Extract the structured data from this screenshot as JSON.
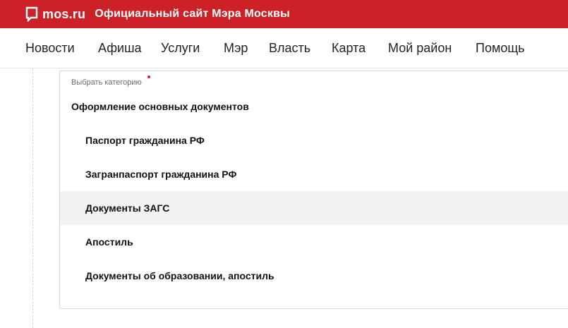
{
  "header": {
    "logo_text": "mos.ru",
    "site_title": "Официальный сайт Мэра Москвы",
    "brand_color": "#cc2127",
    "logo_icon": "speech-bubble-icon"
  },
  "nav": {
    "items": [
      {
        "label": "Новости"
      },
      {
        "label": "Афиша"
      },
      {
        "label": "Услуги"
      },
      {
        "label": "Мэр"
      },
      {
        "label": "Власть"
      },
      {
        "label": "Карта"
      },
      {
        "label": "Мой район"
      },
      {
        "label": "Помощь"
      }
    ]
  },
  "category_select": {
    "label": "Выбрать категорию",
    "required": true,
    "group_title": "Оформление основных документов",
    "options": [
      {
        "label": "Паспорт гражданина РФ",
        "highlighted": false
      },
      {
        "label": "Загранпаспорт гражданина РФ",
        "highlighted": false
      },
      {
        "label": "Документы ЗАГС",
        "highlighted": true
      },
      {
        "label": "Апостиль",
        "highlighted": false
      },
      {
        "label": "Документы об образовании, апостиль",
        "highlighted": false
      }
    ],
    "highlight_color": "#f2f2f4"
  }
}
